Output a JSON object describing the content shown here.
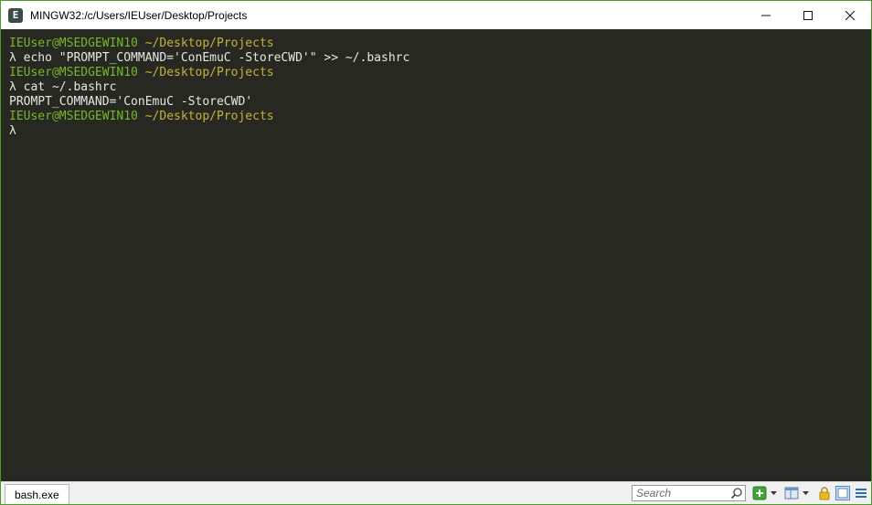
{
  "window": {
    "title": "MINGW32:/c/Users/IEUser/Desktop/Projects",
    "app_icon_glyph": "E"
  },
  "colors": {
    "terminal_bg": "#272822",
    "user_host": "#76b82a",
    "path": "#c8b13a",
    "text": "#e8e8e2",
    "border_accent": "#4c9a2a"
  },
  "terminal": {
    "lines": [
      {
        "type": "prompt",
        "user_host": "IEUser@MSEDGEWIN10",
        "path": "~/Desktop/Projects"
      },
      {
        "type": "command",
        "text": "λ echo \"PROMPT_COMMAND='ConEmuC -StoreCWD'\" >> ~/.bashrc"
      },
      {
        "type": "prompt",
        "user_host": "IEUser@MSEDGEWIN10",
        "path": "~/Desktop/Projects"
      },
      {
        "type": "command",
        "text": "λ cat ~/.bashrc"
      },
      {
        "type": "output",
        "text": "PROMPT_COMMAND='ConEmuC -StoreCWD'"
      },
      {
        "type": "prompt",
        "user_host": "IEUser@MSEDGEWIN10",
        "path": "~/Desktop/Projects"
      },
      {
        "type": "command",
        "text": "λ"
      }
    ]
  },
  "statusbar": {
    "active_tab": "bash.exe",
    "search_placeholder": "Search",
    "icons": [
      "new-console-icon",
      "dropdown-arrow-icon",
      "split-icon",
      "dropdown-arrow-icon",
      "lock-icon",
      "view-icon",
      "menu-icon"
    ]
  }
}
